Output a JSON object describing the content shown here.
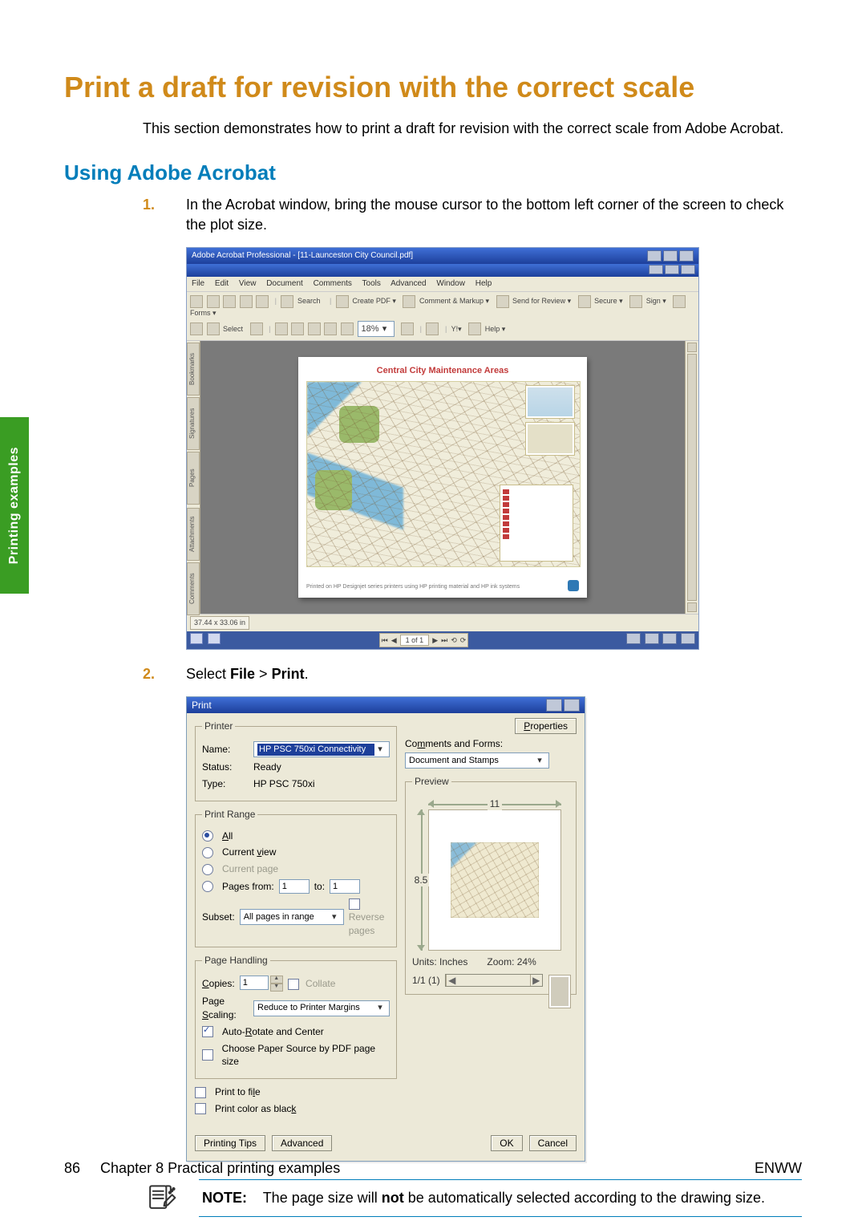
{
  "side_tab": "Printing examples",
  "heading": "Print a draft for revision with the correct scale",
  "intro": "This section demonstrates how to print a draft for revision with the correct scale from Adobe Acrobat.",
  "subheading": "Using Adobe Acrobat",
  "steps": {
    "s1": "In the Acrobat window, bring the mouse cursor to the bottom left corner of the screen to check the plot size.",
    "s2_pre": "Select ",
    "s2_file": "File",
    "s2_gt": " > ",
    "s2_print": "Print",
    "s2_post": "."
  },
  "acrobat": {
    "title": "Adobe Acrobat Professional - [11-Launceston City Council.pdf]",
    "menus": {
      "file": "File",
      "edit": "Edit",
      "view": "View",
      "document": "Document",
      "comments": "Comments",
      "tools": "Tools",
      "advanced": "Advanced",
      "window": "Window",
      "help": "Help"
    },
    "toolbar1": {
      "search": "Search",
      "createpdf": "Create PDF ▾",
      "comment_markup": "Comment & Markup ▾",
      "send_review": "Send for Review ▾",
      "secure": "Secure ▾",
      "sign": "Sign ▾",
      "forms": "Forms ▾"
    },
    "toolbar2": {
      "select": "Select",
      "zoom": "18%",
      "yahoo": "Y!▾",
      "help": "Help ▾"
    },
    "tabs": {
      "pages": "Pages",
      "signatures": "Signatures",
      "bookmarks": "Bookmarks",
      "attachments": "Attachments",
      "comments": "Comments"
    },
    "doc_title": "Central City Maintenance Areas",
    "doc_footnote": "Printed on HP Designjet series printers using HP printing material and HP ink systems",
    "dim": "37.44 x 33.06 in",
    "page_indicator": "1 of 1"
  },
  "print": {
    "title": "Print",
    "printer_legend": "Printer",
    "name_label": "Name:",
    "name_value": "HP PSC 750xi Connectivity",
    "status_label": "Status:",
    "status_value": "Ready",
    "type_label": "Type:",
    "type_value": "HP PSC 750xi",
    "properties_btn": "Properties",
    "comments_label": "Comments and Forms:",
    "comments_value": "Document and Stamps",
    "range_legend": "Print Range",
    "range_all": "All",
    "range_current": "Current view",
    "range_curpage": "Current page",
    "range_pages": "Pages from:",
    "range_to": "to:",
    "range_from_val": "1",
    "range_to_val": "1",
    "subset_label": "Subset:",
    "subset_value": "All pages in range",
    "reverse": "Reverse pages",
    "handling_legend": "Page Handling",
    "copies_label": "Copies:",
    "copies_value": "1",
    "collate": "Collate",
    "scaling_label": "Page Scaling:",
    "scaling_value": "Reduce to Printer Margins",
    "autorotate": "Auto-Rotate and Center",
    "choose_source": "Choose Paper Source by PDF page size",
    "print_to_file": "Print to file",
    "print_black": "Print color as black",
    "preview_legend": "Preview",
    "preview_width": "11",
    "preview_height": "8.5",
    "units_label": "Units:",
    "units_value": "Inches",
    "zoom_label": "Zoom:",
    "zoom_value": "24%",
    "page_nav": "1/1 (1)",
    "tips_btn": "Printing Tips",
    "advanced_btn": "Advanced",
    "ok_btn": "OK",
    "cancel_btn": "Cancel"
  },
  "note": {
    "label": "NOTE:",
    "pre": "The page size will ",
    "bold": "not",
    "post": " be automatically selected according to the drawing size."
  },
  "footer": {
    "page_number": "86",
    "chapter": "Chapter 8   Practical printing examples",
    "right": "ENWW"
  }
}
